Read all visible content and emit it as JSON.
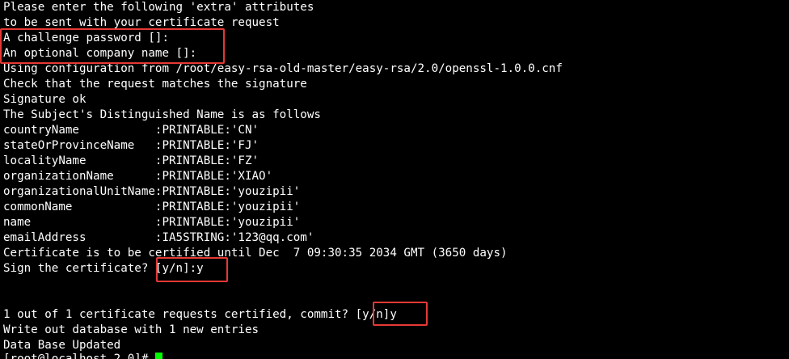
{
  "terminal": {
    "lines": [
      "Please enter the following 'extra' attributes",
      "to be sent with your certificate request",
      "A challenge password []:",
      "An optional company name []:",
      "Using configuration from /root/easy-rsa-old-master/easy-rsa/2.0/openssl-1.0.0.cnf",
      "Check that the request matches the signature",
      "Signature ok",
      "The Subject's Distinguished Name is as follows",
      "countryName           :PRINTABLE:'CN'",
      "stateOrProvinceName   :PRINTABLE:'FJ'",
      "localityName          :PRINTABLE:'FZ'",
      "organizationName      :PRINTABLE:'XIAO'",
      "organizationalUnitName:PRINTABLE:'youzipii'",
      "commonName            :PRINTABLE:'youzipii'",
      "name                  :PRINTABLE:'youzipii'",
      "emailAddress          :IA5STRING:'123@qq.com'",
      "Certificate is to be certified until Dec  7 09:30:35 2034 GMT (3650 days)",
      "Sign the certificate? [y/n]:y",
      "",
      "",
      "1 out of 1 certificate requests certified, commit? [y/n]y",
      "Write out database with 1 new entries",
      "Data Base Updated",
      "[root@localhost 2.0]# "
    ],
    "cursor_color": "#00ff00",
    "highlight_color": "#e53935"
  }
}
